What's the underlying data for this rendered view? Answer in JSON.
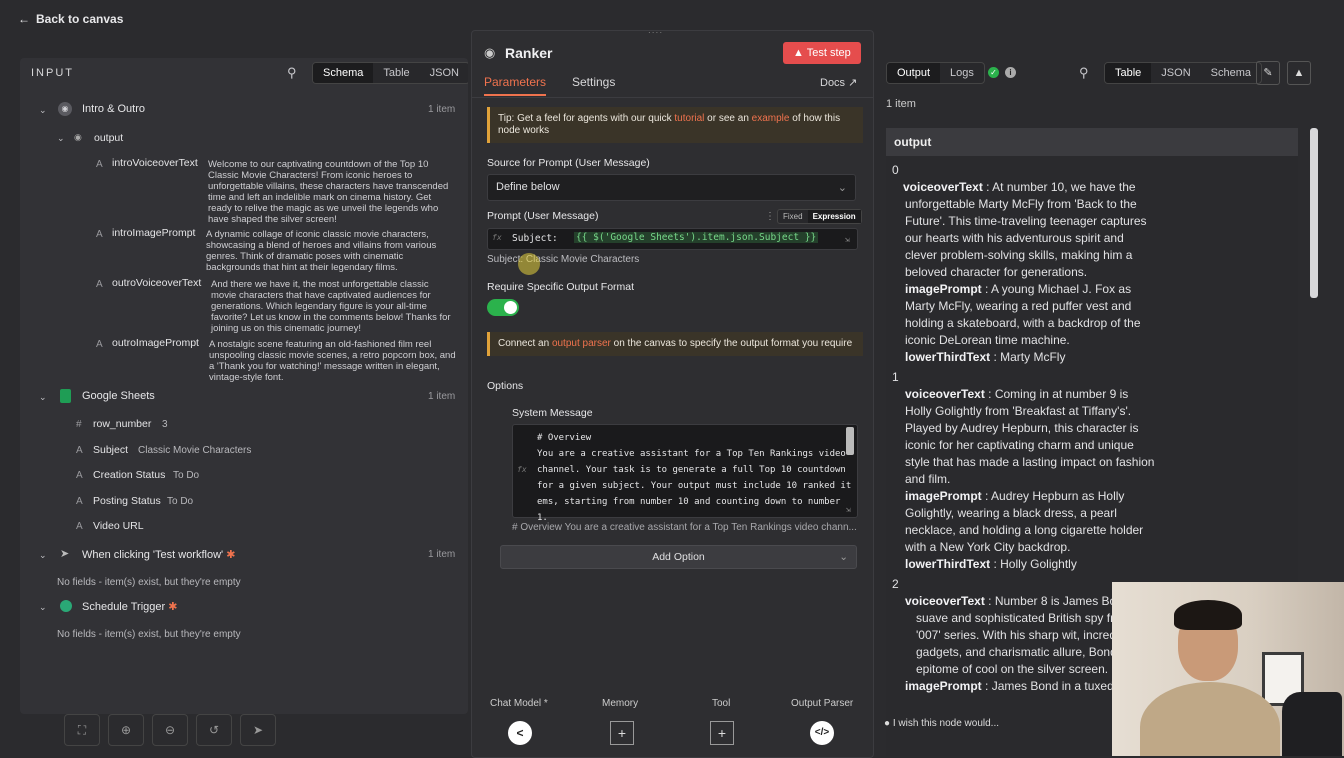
{
  "back_label": "Back to canvas",
  "input": {
    "title": "INPUT",
    "tabs": [
      "Schema",
      "Table",
      "JSON"
    ],
    "nodes": [
      {
        "name": "Intro & Outro",
        "count": "1 item",
        "sub": "output",
        "fields": [
          {
            "name": "introVoiceoverText",
            "value": "Welcome to our captivating countdown of the Top 10 Classic Movie Characters! From iconic heroes to unforgettable villains, these characters have transcended time and left an indelible mark on cinema history. Get ready to relive the magic as we unveil the legends who have shaped the silver screen!"
          },
          {
            "name": "introImagePrompt",
            "value": "A dynamic collage of iconic classic movie characters, showcasing a blend of heroes and villains from various genres. Think of dramatic poses with cinematic backgrounds that hint at their legendary films."
          },
          {
            "name": "outroVoiceoverText",
            "value": "And there we have it, the most unforgettable classic movie characters that have captivated audiences for generations. Which legendary figure is your all-time favorite? Let us know in the comments below! Thanks for joining us on this cinematic journey!"
          },
          {
            "name": "outroImagePrompt",
            "value": "A nostalgic scene featuring an old-fashioned film reel unspooling classic movie scenes, a retro popcorn box, and a 'Thank you for watching!' message written in elegant, vintage-style font."
          }
        ]
      },
      {
        "name": "Google Sheets",
        "count": "1 item",
        "fields": [
          {
            "type": "#",
            "name": "row_number",
            "value": "3"
          },
          {
            "type": "A",
            "name": "Subject",
            "value": "Classic Movie Characters"
          },
          {
            "type": "A",
            "name": "Creation Status",
            "value": "To Do"
          },
          {
            "type": "A",
            "name": "Posting Status",
            "value": "To Do"
          },
          {
            "type": "A",
            "name": "Video URL",
            "value": ""
          }
        ]
      },
      {
        "name": "When clicking 'Test workflow'",
        "count": "1 item",
        "empty": "No fields - item(s) exist, but they're empty"
      },
      {
        "name": "Schedule Trigger",
        "count": "",
        "empty": "No fields - item(s) exist, but they're empty"
      }
    ]
  },
  "node": {
    "title": "Ranker",
    "test_button": "Test step",
    "tabs": [
      "Parameters",
      "Settings"
    ],
    "docs": "Docs",
    "tip": {
      "pre": "Tip: Get a feel for agents with our quick ",
      "link1": "tutorial",
      "mid": " or see an ",
      "link2": "example",
      "post": " of how this node works"
    },
    "source_label": "Source for Prompt (User Message)",
    "source_value": "Define below",
    "prompt_label": "Prompt (User Message)",
    "mode_fixed": "Fixed",
    "mode_expression": "Expression",
    "prompt_prefix": "Subject: ",
    "prompt_expr": "{{ $('Google Sheets').item.json.Subject }}",
    "prompt_result": "Subject: Classic Movie Characters",
    "require_label": "Require Specific Output Format",
    "connect": {
      "pre": "Connect an ",
      "link": "output parser",
      "post": " on the canvas to specify the output format you require"
    },
    "options_label": "Options",
    "system_label": "System Message",
    "system_lines": [
      "# Overview",
      "You are a creative assistant for a Top Ten Rankings video",
      "channel. Your task is to generate a full Top 10 countdown",
      "for a given subject. Your output must include 10 ranked it",
      "ems, starting from number 10 and counting down to number",
      "1."
    ],
    "system_preview": "# Overview You are a creative assistant for a Top Ten Rankings video chann...",
    "add_option": "Add Option",
    "connectors": [
      "Chat Model *",
      "Memory",
      "Tool",
      "Output Parser"
    ]
  },
  "output": {
    "tabs": [
      "Output",
      "Logs"
    ],
    "view_tabs": [
      "Table",
      "JSON",
      "Schema"
    ],
    "count": "1 item",
    "header": "output",
    "items": [
      {
        "index": "0",
        "voiceoverText": "At number 10, we have the unforgettable Marty McFly from 'Back to the Future'. This time-traveling teenager captures our hearts with his adventurous spirit and clever problem-solving skills, making him a beloved character for generations.",
        "imagePrompt": "A young Michael J. Fox as Marty McFly, wearing a red puffer vest and holding a skateboard, with a backdrop of the iconic DeLorean time machine.",
        "lowerThirdText": "Marty McFly"
      },
      {
        "index": "1",
        "voiceoverText": "Coming in at number 9 is Holly Golightly from 'Breakfast at Tiffany's'. Played by Audrey Hepburn, this character is iconic for her captivating charm and unique style that has made a lasting impact on fashion and film.",
        "imagePrompt": "Audrey Hepburn as Holly Golightly, wearing a black dress, a pearl necklace, and holding a long cigarette holder with a New York City backdrop.",
        "lowerThirdText": "Holly Golightly"
      },
      {
        "index": "2",
        "voiceoverText": "Number 8 is James Bon",
        "voiceoverText_l2": "suave and sophisticated British spy fr",
        "voiceoverText_l3": "'007' series. With his sharp wit, incred",
        "voiceoverText_l4": "gadgets, and charismatic allure, Bond",
        "voiceoverText_l5": "epitome of cool on the silver screen.",
        "imagePrompt": "James Bond in a tuxedo"
      }
    ],
    "keys": {
      "voiceover": "voiceoverText",
      "image": "imagePrompt",
      "lower": "lowerThirdText"
    },
    "feedback": "I wish this node would..."
  }
}
